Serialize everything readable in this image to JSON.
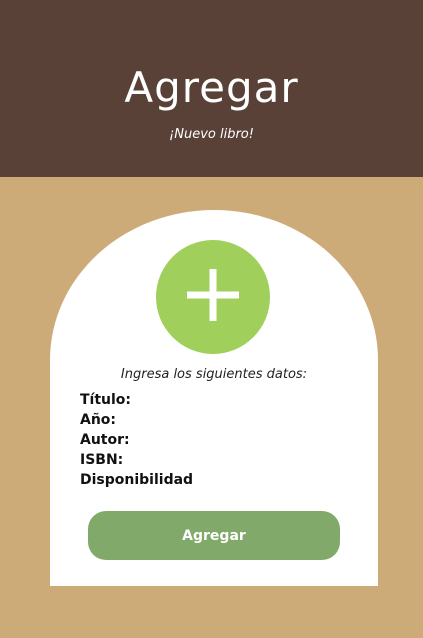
{
  "header": {
    "title": "Agregar",
    "subtitle": "¡Nuevo libro!"
  },
  "card": {
    "add_icon": "plus-icon",
    "instructions": "Ingresa los siguientes datos:",
    "fields": [
      {
        "label": "Título:"
      },
      {
        "label": "Año:"
      },
      {
        "label": "Autor:"
      },
      {
        "label": "ISBN:"
      },
      {
        "label": "Disponibilidad"
      }
    ],
    "submit_label": "Agregar"
  },
  "colors": {
    "background": "#cdab79",
    "header": "#5a4137",
    "card": "#ffffff",
    "accent_circle": "#a0cf5c",
    "button": "#80a96a"
  }
}
